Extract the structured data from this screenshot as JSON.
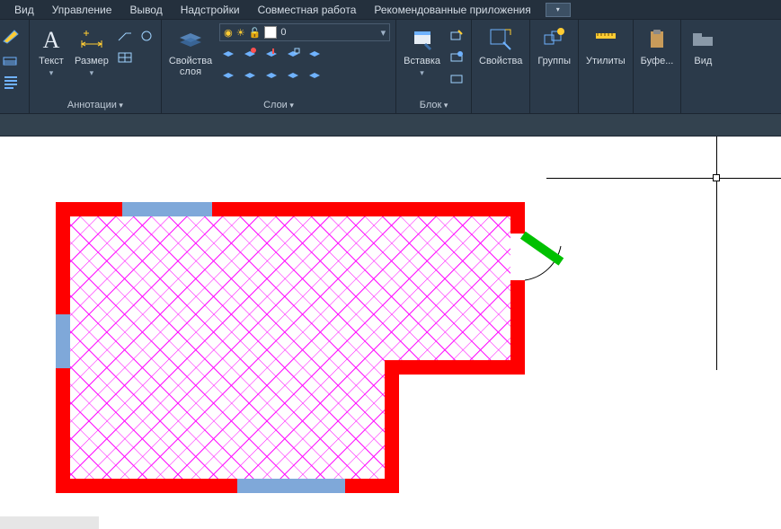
{
  "menu": {
    "items": [
      "Вид",
      "Управление",
      "Вывод",
      "Надстройки",
      "Совместная работа",
      "Рекомендованные приложения"
    ]
  },
  "ribbon": {
    "groups": {
      "annotations": {
        "title": "Аннотации",
        "text": "Текст",
        "dimension": "Размер"
      },
      "layers": {
        "title": "Слои",
        "props": "Свойства\nслоя",
        "current_layer": "0"
      },
      "block": {
        "title": "Блок",
        "insert": "Вставка"
      },
      "properties": {
        "title": "Свойства"
      },
      "groupsg": {
        "title": "Группы"
      },
      "utilities": {
        "title": "Утилиты"
      },
      "clipboard": {
        "title": "Буфе..."
      },
      "view": {
        "title": "Вид"
      }
    }
  }
}
